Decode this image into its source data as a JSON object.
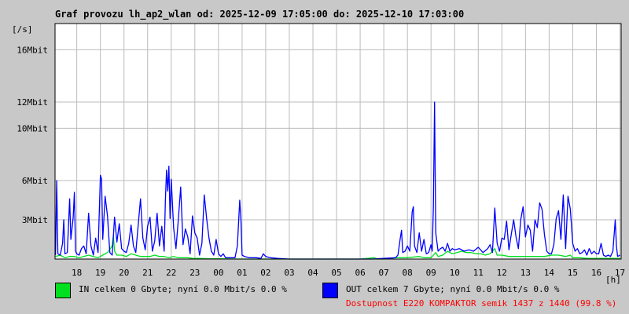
{
  "page": {
    "background": "#c8c8c8"
  },
  "chart_data": {
    "type": "line",
    "title": "Graf provozu lh_ap2_wlan od: 2025-12-09 17:05:00 do: 2025-12-10 17:03:00",
    "ylabel": "[/s]",
    "xlabel": "[h]",
    "x_ticks": [
      "18",
      "19",
      "20",
      "21",
      "22",
      "23",
      "00",
      "01",
      "02",
      "03",
      "04",
      "05",
      "06",
      "07",
      "08",
      "09",
      "10",
      "11",
      "12",
      "13",
      "14",
      "15",
      "16",
      "17"
    ],
    "y_ticks": [
      {
        "value": 3,
        "label": "3Mbit"
      },
      {
        "value": 6,
        "label": "6Mbit"
      },
      {
        "value": 10,
        "label": "10Mbit"
      },
      {
        "value": 12,
        "label": "12Mbit"
      },
      {
        "value": 16,
        "label": "16Mbit"
      }
    ],
    "xlim": [
      17.08,
      41.05
    ],
    "ylim": [
      0,
      18
    ],
    "grid": true,
    "series": [
      {
        "name": "IN",
        "color": "#00e020",
        "points": [
          [
            17.1,
            0.2
          ],
          [
            17.3,
            0.3
          ],
          [
            17.5,
            0.1
          ],
          [
            17.7,
            0.2
          ],
          [
            17.9,
            0.2
          ],
          [
            18.1,
            0.1
          ],
          [
            18.3,
            0.2
          ],
          [
            18.5,
            0.3
          ],
          [
            18.7,
            0.2
          ],
          [
            18.9,
            0.1
          ],
          [
            19.1,
            0.3
          ],
          [
            19.3,
            0.5
          ],
          [
            19.5,
            1.0
          ],
          [
            19.55,
            1.8
          ],
          [
            19.6,
            0.6
          ],
          [
            19.7,
            0.3
          ],
          [
            19.9,
            0.3
          ],
          [
            20.1,
            0.2
          ],
          [
            20.3,
            0.4
          ],
          [
            20.5,
            0.3
          ],
          [
            20.7,
            0.2
          ],
          [
            20.9,
            0.2
          ],
          [
            21.1,
            0.2
          ],
          [
            21.3,
            0.3
          ],
          [
            21.5,
            0.2
          ],
          [
            21.7,
            0.2
          ],
          [
            21.9,
            0.1
          ],
          [
            22.1,
            0.2
          ],
          [
            22.3,
            0.1
          ],
          [
            22.5,
            0.1
          ],
          [
            22.7,
            0.1
          ],
          [
            22.9,
            0.05
          ],
          [
            23.2,
            0.05
          ],
          [
            23.6,
            0.02
          ],
          [
            24.0,
            0.02
          ],
          [
            25.0,
            0.0
          ],
          [
            26.0,
            0.0
          ],
          [
            27.0,
            0.0
          ],
          [
            28.0,
            0.0
          ],
          [
            29.0,
            0.0
          ],
          [
            30.0,
            0.0
          ],
          [
            30.6,
            0.1
          ],
          [
            30.7,
            0.0
          ],
          [
            31.0,
            0.0
          ],
          [
            31.5,
            0.1
          ],
          [
            32.0,
            0.1
          ],
          [
            32.5,
            0.2
          ],
          [
            32.7,
            0.1
          ],
          [
            33.0,
            0.1
          ],
          [
            33.2,
            0.5
          ],
          [
            33.3,
            0.2
          ],
          [
            33.5,
            0.3
          ],
          [
            33.7,
            0.6
          ],
          [
            33.9,
            0.4
          ],
          [
            34.1,
            0.5
          ],
          [
            34.3,
            0.6
          ],
          [
            34.5,
            0.5
          ],
          [
            34.7,
            0.5
          ],
          [
            34.9,
            0.4
          ],
          [
            35.1,
            0.4
          ],
          [
            35.3,
            0.3
          ],
          [
            35.5,
            0.4
          ],
          [
            35.7,
            0.8
          ],
          [
            35.8,
            0.3
          ],
          [
            36.0,
            0.3
          ],
          [
            36.3,
            0.2
          ],
          [
            36.6,
            0.2
          ],
          [
            36.9,
            0.2
          ],
          [
            37.2,
            0.2
          ],
          [
            37.5,
            0.2
          ],
          [
            37.8,
            0.2
          ],
          [
            38.1,
            0.3
          ],
          [
            38.4,
            0.3
          ],
          [
            38.7,
            0.2
          ],
          [
            38.9,
            0.3
          ],
          [
            39.0,
            0.1
          ],
          [
            39.3,
            0.1
          ],
          [
            39.6,
            0.05
          ],
          [
            39.9,
            0.05
          ],
          [
            40.2,
            0.05
          ],
          [
            40.5,
            0.05
          ],
          [
            41.0,
            0.05
          ]
        ]
      },
      {
        "name": "OUT",
        "color": "#0000ff",
        "points": [
          [
            17.1,
            0.3
          ],
          [
            17.15,
            6.0
          ],
          [
            17.2,
            0.4
          ],
          [
            17.3,
            0.3
          ],
          [
            17.4,
            1.2
          ],
          [
            17.45,
            3.0
          ],
          [
            17.5,
            0.4
          ],
          [
            17.6,
            0.5
          ],
          [
            17.7,
            4.6
          ],
          [
            17.75,
            1.5
          ],
          [
            17.85,
            3.2
          ],
          [
            17.9,
            5.1
          ],
          [
            17.95,
            0.6
          ],
          [
            18.0,
            0.4
          ],
          [
            18.1,
            0.3
          ],
          [
            18.2,
            0.8
          ],
          [
            18.3,
            1.0
          ],
          [
            18.4,
            0.4
          ],
          [
            18.5,
            3.5
          ],
          [
            18.6,
            1.0
          ],
          [
            18.7,
            0.3
          ],
          [
            18.8,
            1.6
          ],
          [
            18.9,
            0.5
          ],
          [
            19.0,
            6.4
          ],
          [
            19.05,
            6.1
          ],
          [
            19.1,
            1.5
          ],
          [
            19.2,
            4.8
          ],
          [
            19.3,
            3.3
          ],
          [
            19.4,
            0.5
          ],
          [
            19.5,
            0.3
          ],
          [
            19.6,
            3.2
          ],
          [
            19.7,
            1.3
          ],
          [
            19.8,
            2.7
          ],
          [
            19.9,
            0.8
          ],
          [
            20.0,
            0.6
          ],
          [
            20.1,
            0.5
          ],
          [
            20.2,
            1.2
          ],
          [
            20.3,
            2.6
          ],
          [
            20.4,
            1.0
          ],
          [
            20.5,
            0.5
          ],
          [
            20.7,
            4.6
          ],
          [
            20.8,
            1.6
          ],
          [
            20.9,
            0.7
          ],
          [
            21.0,
            2.5
          ],
          [
            21.1,
            3.2
          ],
          [
            21.2,
            0.6
          ],
          [
            21.3,
            1.4
          ],
          [
            21.4,
            3.5
          ],
          [
            21.5,
            1.0
          ],
          [
            21.6,
            2.5
          ],
          [
            21.7,
            0.6
          ],
          [
            21.75,
            4.4
          ],
          [
            21.8,
            6.8
          ],
          [
            21.85,
            5.2
          ],
          [
            21.9,
            7.1
          ],
          [
            21.95,
            3.1
          ],
          [
            22.0,
            6.1
          ],
          [
            22.1,
            2.4
          ],
          [
            22.2,
            0.8
          ],
          [
            22.3,
            3.0
          ],
          [
            22.4,
            5.5
          ],
          [
            22.5,
            1.1
          ],
          [
            22.6,
            2.3
          ],
          [
            22.7,
            1.7
          ],
          [
            22.8,
            0.4
          ],
          [
            22.9,
            3.3
          ],
          [
            23.0,
            2.0
          ],
          [
            23.1,
            1.6
          ],
          [
            23.2,
            0.3
          ],
          [
            23.3,
            1.2
          ],
          [
            23.4,
            4.9
          ],
          [
            23.5,
            3.1
          ],
          [
            23.6,
            1.6
          ],
          [
            23.7,
            0.6
          ],
          [
            23.8,
            0.3
          ],
          [
            23.9,
            1.5
          ],
          [
            24.0,
            0.4
          ],
          [
            24.1,
            0.2
          ],
          [
            24.2,
            0.4
          ],
          [
            24.3,
            0.1
          ],
          [
            24.5,
            0.1
          ],
          [
            24.7,
            0.1
          ],
          [
            24.8,
            1.0
          ],
          [
            24.9,
            4.5
          ],
          [
            24.95,
            3.0
          ],
          [
            25.0,
            0.3
          ],
          [
            25.1,
            0.2
          ],
          [
            25.3,
            0.1
          ],
          [
            25.6,
            0.1
          ],
          [
            25.8,
            0.05
          ],
          [
            25.9,
            0.4
          ],
          [
            26.0,
            0.2
          ],
          [
            26.2,
            0.1
          ],
          [
            26.5,
            0.05
          ],
          [
            27.0,
            0.0
          ],
          [
            27.5,
            0.0
          ],
          [
            28.0,
            0.0
          ],
          [
            29.0,
            0.0
          ],
          [
            30.0,
            0.0
          ],
          [
            30.5,
            0.0
          ],
          [
            31.0,
            0.05
          ],
          [
            31.5,
            0.1
          ],
          [
            31.6,
            0.3
          ],
          [
            31.7,
            1.6
          ],
          [
            31.75,
            2.2
          ],
          [
            31.8,
            0.5
          ],
          [
            31.9,
            0.6
          ],
          [
            32.0,
            1.0
          ],
          [
            32.1,
            0.6
          ],
          [
            32.2,
            3.6
          ],
          [
            32.25,
            4.0
          ],
          [
            32.3,
            1.0
          ],
          [
            32.4,
            0.5
          ],
          [
            32.5,
            2.0
          ],
          [
            32.6,
            0.6
          ],
          [
            32.7,
            1.5
          ],
          [
            32.8,
            0.4
          ],
          [
            32.9,
            0.5
          ],
          [
            33.0,
            1.1
          ],
          [
            33.05,
            0.6
          ],
          [
            33.1,
            4.0
          ],
          [
            33.15,
            12.0
          ],
          [
            33.2,
            2.0
          ],
          [
            33.3,
            0.6
          ],
          [
            33.4,
            0.8
          ],
          [
            33.5,
            0.9
          ],
          [
            33.6,
            0.6
          ],
          [
            33.7,
            1.2
          ],
          [
            33.8,
            0.6
          ],
          [
            33.9,
            0.8
          ],
          [
            34.0,
            0.7
          ],
          [
            34.2,
            0.8
          ],
          [
            34.4,
            0.6
          ],
          [
            34.6,
            0.7
          ],
          [
            34.8,
            0.6
          ],
          [
            35.0,
            0.9
          ],
          [
            35.2,
            0.5
          ],
          [
            35.4,
            0.8
          ],
          [
            35.5,
            1.1
          ],
          [
            35.6,
            0.5
          ],
          [
            35.7,
            3.9
          ],
          [
            35.8,
            1.2
          ],
          [
            35.9,
            0.6
          ],
          [
            36.0,
            1.6
          ],
          [
            36.1,
            1.5
          ],
          [
            36.2,
            2.9
          ],
          [
            36.3,
            0.7
          ],
          [
            36.4,
            1.9
          ],
          [
            36.5,
            3.0
          ],
          [
            36.6,
            1.7
          ],
          [
            36.7,
            0.8
          ],
          [
            36.8,
            3.0
          ],
          [
            36.9,
            4.0
          ],
          [
            37.0,
            1.7
          ],
          [
            37.1,
            2.6
          ],
          [
            37.2,
            2.2
          ],
          [
            37.3,
            0.6
          ],
          [
            37.4,
            3.0
          ],
          [
            37.5,
            2.4
          ],
          [
            37.6,
            4.3
          ],
          [
            37.7,
            3.8
          ],
          [
            37.8,
            1.9
          ],
          [
            37.9,
            0.6
          ],
          [
            38.0,
            0.4
          ],
          [
            38.1,
            0.4
          ],
          [
            38.2,
            1.1
          ],
          [
            38.3,
            3.1
          ],
          [
            38.4,
            3.7
          ],
          [
            38.5,
            1.5
          ],
          [
            38.6,
            4.9
          ],
          [
            38.7,
            0.8
          ],
          [
            38.8,
            4.8
          ],
          [
            38.9,
            3.8
          ],
          [
            39.0,
            1.2
          ],
          [
            39.1,
            0.6
          ],
          [
            39.2,
            0.8
          ],
          [
            39.3,
            0.4
          ],
          [
            39.4,
            0.5
          ],
          [
            39.5,
            0.7
          ],
          [
            39.6,
            0.3
          ],
          [
            39.7,
            0.8
          ],
          [
            39.8,
            0.4
          ],
          [
            39.9,
            0.6
          ],
          [
            40.0,
            0.4
          ],
          [
            40.1,
            0.4
          ],
          [
            40.2,
            1.2
          ],
          [
            40.3,
            0.3
          ],
          [
            40.4,
            0.2
          ],
          [
            40.5,
            0.3
          ],
          [
            40.6,
            0.2
          ],
          [
            40.7,
            0.6
          ],
          [
            40.8,
            3.0
          ],
          [
            40.85,
            1.0
          ],
          [
            40.9,
            0.2
          ],
          [
            41.0,
            0.3
          ]
        ]
      }
    ]
  },
  "legend": {
    "in": {
      "color": "#00e020",
      "text": "IN celkem 0 Gbyte; nyní   0.0 Mbit/s 0.0 %"
    },
    "out": {
      "color": "#0000ff",
      "text": "OUT celkem 7 Gbyte; nyní   0.0 Mbit/s 0.0 %"
    }
  },
  "availability": "Dostupnost E220 KOMPAKTOR semik 1437 z 1440 (99.8 %)"
}
